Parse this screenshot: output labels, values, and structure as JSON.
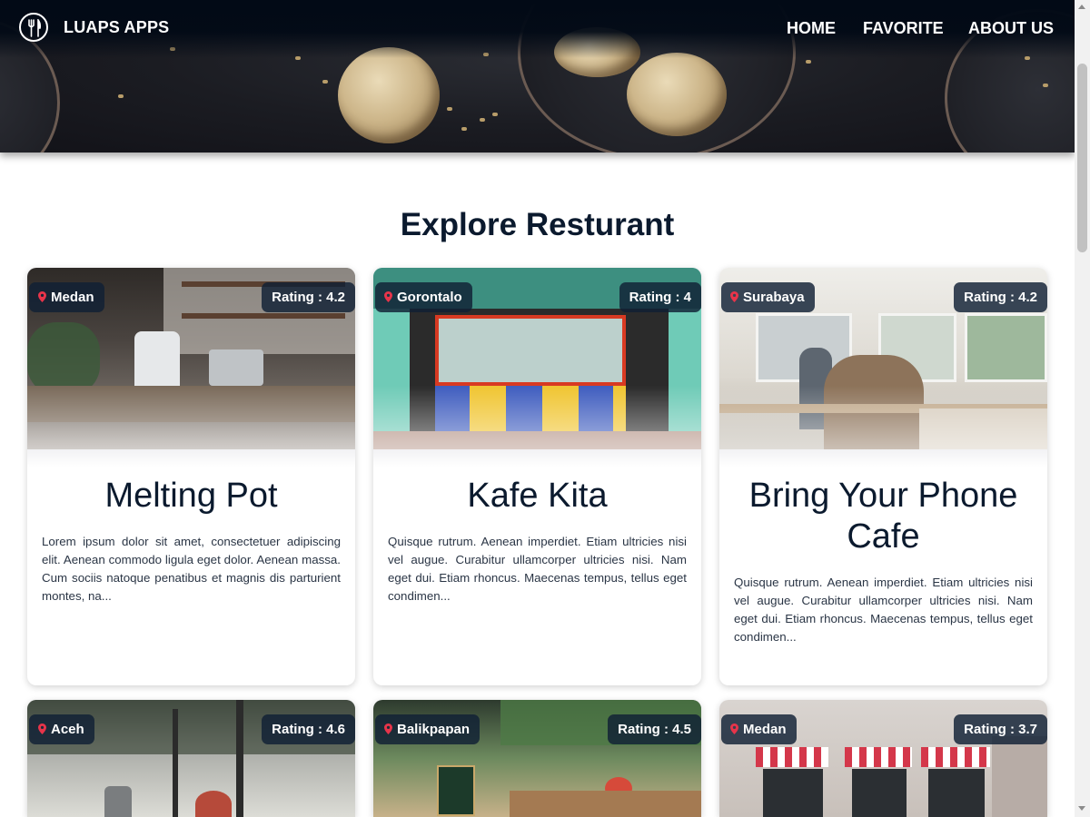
{
  "brand": {
    "name": "LUAPS APPS",
    "logo_icon": "fork-knife-icon"
  },
  "nav": {
    "items": [
      {
        "label": "HOME"
      },
      {
        "label": "FAVORITE"
      },
      {
        "label": "ABOUT US"
      }
    ]
  },
  "section": {
    "title": "Explore Resturant"
  },
  "restaurants": [
    {
      "city": "Medan",
      "rating": "Rating : 4.2",
      "name": "Melting Pot",
      "description": "Lorem ipsum dolor sit amet, consectetuer adipiscing elit. Aenean commodo ligula eget dolor. Aenean massa. Cum sociis natoque penatibus et magnis dis parturient montes, na..."
    },
    {
      "city": "Gorontalo",
      "rating": "Rating : 4",
      "name": "Kafe Kita",
      "description": "Quisque rutrum. Aenean imperdiet. Etiam ultricies nisi vel augue. Curabitur ullamcorper ultricies nisi. Nam eget dui. Etiam rhoncus. Maecenas tempus, tellus eget condimen..."
    },
    {
      "city": "Surabaya",
      "rating": "Rating : 4.2",
      "name": "Bring Your Phone Cafe",
      "description": "Quisque rutrum. Aenean imperdiet. Etiam ultricies nisi vel augue. Curabitur ullamcorper ultricies nisi. Nam eget dui. Etiam rhoncus. Maecenas tempus, tellus eget condimen..."
    },
    {
      "city": "Aceh",
      "rating": "Rating : 4.6"
    },
    {
      "city": "Balikpapan",
      "rating": "Rating : 4.5"
    },
    {
      "city": "Medan",
      "rating": "Rating : 3.7"
    }
  ],
  "colors": {
    "primary_dark": "#0b1a2e",
    "badge_bg": "#102034",
    "pin_red": "#e8344a",
    "navbar_bg": "#020a16"
  }
}
